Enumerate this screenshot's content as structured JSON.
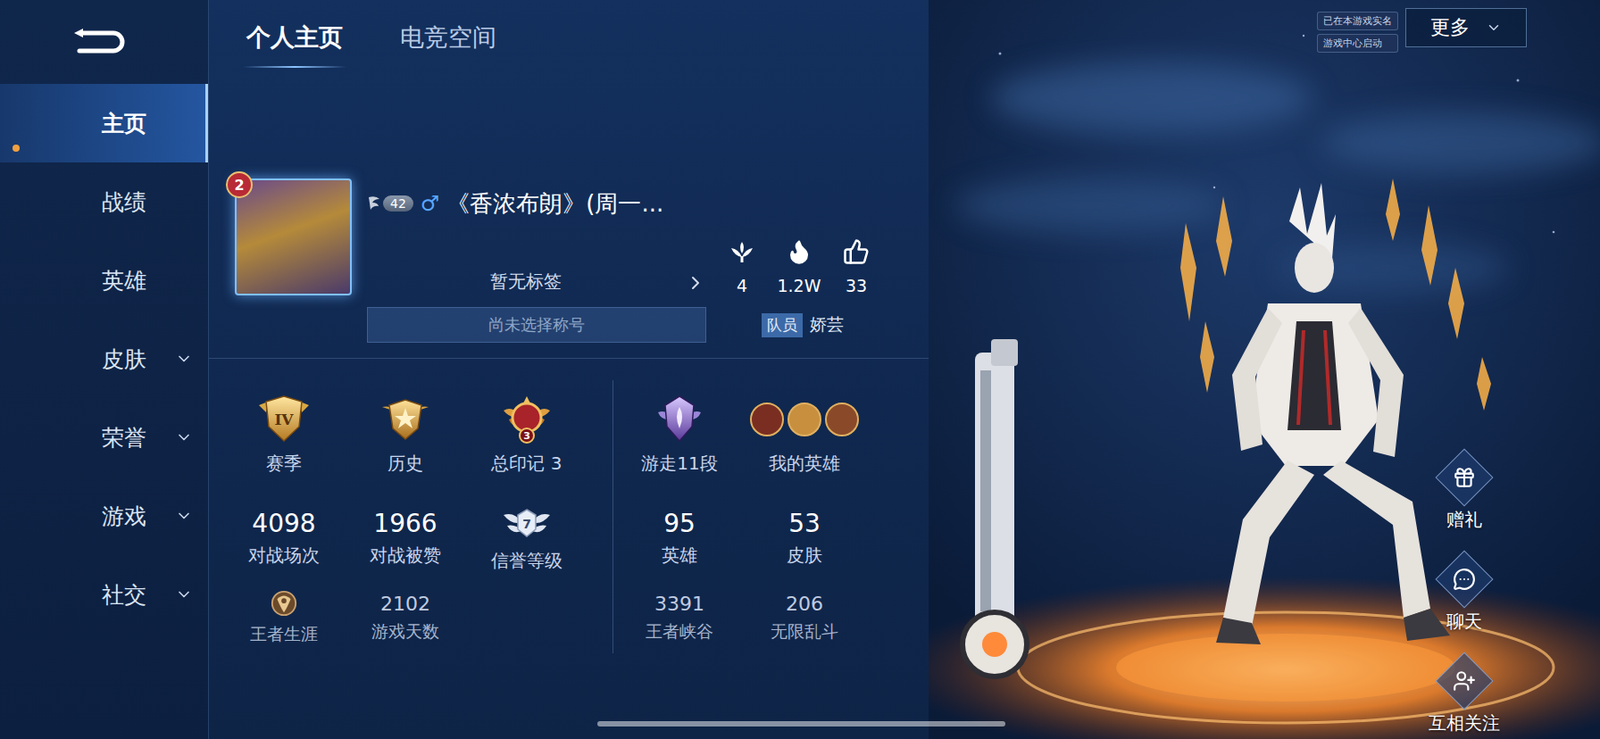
{
  "sidebar": {
    "items": [
      {
        "label": "主页",
        "selected": true,
        "expandable": false
      },
      {
        "label": "战绩",
        "selected": false,
        "expandable": false
      },
      {
        "label": "英雄",
        "selected": false,
        "expandable": false
      },
      {
        "label": "皮肤",
        "selected": false,
        "expandable": true
      },
      {
        "label": "荣誉",
        "selected": false,
        "expandable": true
      },
      {
        "label": "游戏",
        "selected": false,
        "expandable": true
      },
      {
        "label": "社交",
        "selected": false,
        "expandable": true
      }
    ]
  },
  "tabs": [
    {
      "label": "个人主页",
      "selected": true
    },
    {
      "label": "电竞空间",
      "selected": false
    }
  ],
  "realname": [
    "已在本游戏实名",
    "游戏中心启动"
  ],
  "more_button": "更多",
  "profile": {
    "avatar_badge": "2",
    "level": "42",
    "gender": "♂",
    "name": "《香浓布朗》(周一...",
    "tag": "暂无标签",
    "title_placeholder": "尚未选择称号",
    "team_role": "队员",
    "teammate": "娇芸",
    "stats": [
      {
        "kind": "popularity",
        "value": "4"
      },
      {
        "kind": "heat",
        "value": "1.2W"
      },
      {
        "kind": "likes",
        "value": "33"
      }
    ]
  },
  "overview": {
    "left": [
      [
        {
          "kind": "season",
          "badge": "IV",
          "label": "赛季"
        },
        {
          "kind": "history",
          "label": "历史"
        },
        {
          "kind": "mark",
          "badge": "3",
          "label": "总印记 3"
        }
      ],
      [
        {
          "kind": "value",
          "value": "4098",
          "label": "对战场次"
        },
        {
          "kind": "value",
          "value": "1966",
          "label": "对战被赞"
        },
        {
          "kind": "credit",
          "badge": "7",
          "label": "信誉等级"
        }
      ],
      [
        {
          "kind": "career",
          "label": "王者生涯"
        },
        {
          "kind": "minor",
          "value": "2102",
          "label": "游戏天数"
        }
      ]
    ],
    "right": [
      [
        {
          "kind": "rank",
          "label": "游走11段"
        },
        {
          "kind": "heroes",
          "label": "我的英雄",
          "portraits": [
            {
              "color": "#7a2e22"
            },
            {
              "color": "#c8903e"
            },
            {
              "color": "#8a4a2a"
            }
          ]
        }
      ],
      [
        {
          "kind": "value",
          "value": "95",
          "label": "英雄"
        },
        {
          "kind": "value",
          "value": "53",
          "label": "皮肤"
        }
      ],
      [
        {
          "kind": "minor",
          "value": "3391",
          "label": "王者峡谷"
        },
        {
          "kind": "minor",
          "value": "206",
          "label": "无限乱斗"
        }
      ]
    ]
  },
  "actions": [
    {
      "kind": "gift",
      "label": "赠礼"
    },
    {
      "kind": "chat",
      "label": "聊天"
    },
    {
      "kind": "follow",
      "label": "互相关注"
    }
  ]
}
